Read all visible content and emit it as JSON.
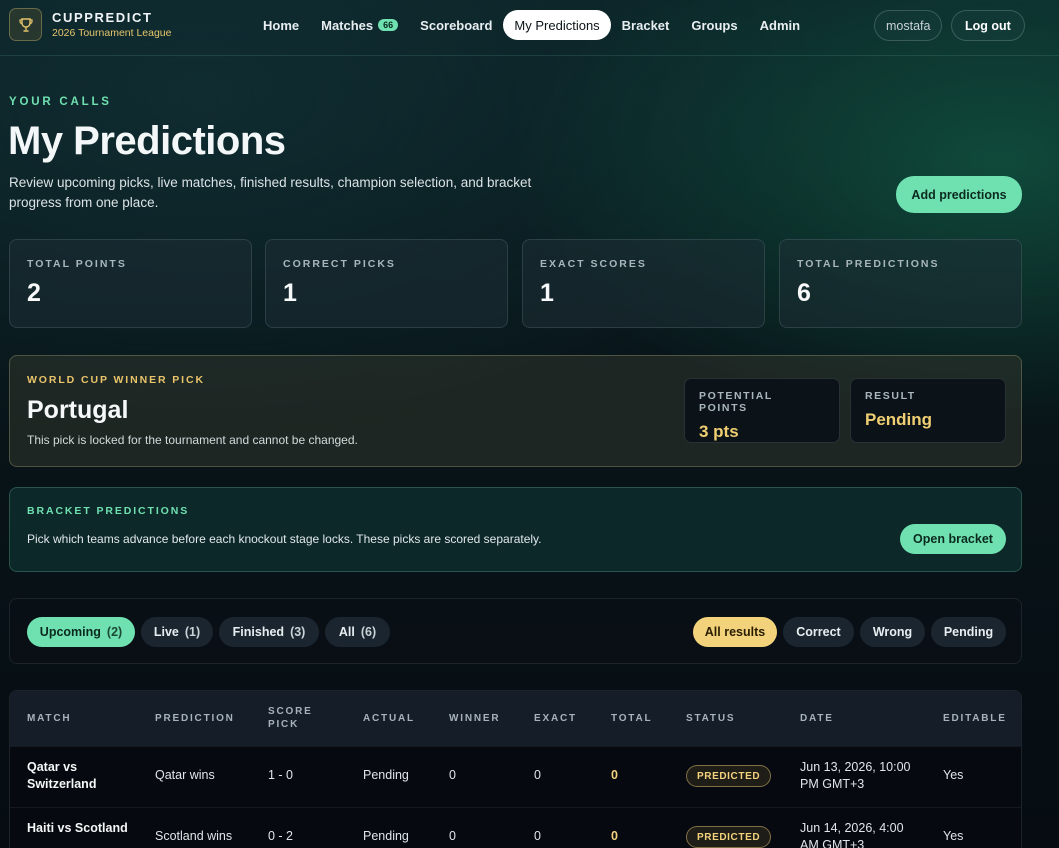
{
  "nav": {
    "brand_name": "CUPPREDICT",
    "brand_sub": "2026 Tournament League",
    "links": [
      {
        "label": "Home"
      },
      {
        "label": "Matches",
        "badge": "66"
      },
      {
        "label": "Scoreboard"
      },
      {
        "label": "My Predictions"
      },
      {
        "label": "Bracket"
      },
      {
        "label": "Groups"
      },
      {
        "label": "Admin"
      }
    ],
    "user": "mostafa",
    "logout": "Log out"
  },
  "header": {
    "eyebrow": "YOUR CALLS",
    "title": "My Predictions",
    "description": "Review upcoming picks, live matches, finished results, champion selection, and bracket progress from one place.",
    "add_button": "Add predictions"
  },
  "stats": [
    {
      "label": "TOTAL POINTS",
      "value": "2"
    },
    {
      "label": "CORRECT PICKS",
      "value": "1"
    },
    {
      "label": "EXACT SCORES",
      "value": "1"
    },
    {
      "label": "TOTAL PREDICTIONS",
      "value": "6"
    }
  ],
  "winner_pick": {
    "label": "WORLD CUP WINNER PICK",
    "team": "Portugal",
    "note": "This pick is locked for the tournament and cannot be changed.",
    "potential_label": "POTENTIAL POINTS",
    "potential_value": "3 pts",
    "result_label": "RESULT",
    "result_value": "Pending"
  },
  "bracket": {
    "label": "BRACKET PREDICTIONS",
    "note": "Pick which teams advance before each knockout stage locks. These picks are scored separately.",
    "button": "Open bracket"
  },
  "filters": {
    "tabs": [
      {
        "label": "Upcoming",
        "count": "(2)"
      },
      {
        "label": "Live",
        "count": "(1)"
      },
      {
        "label": "Finished",
        "count": "(3)"
      },
      {
        "label": "All",
        "count": "(6)"
      }
    ],
    "results": [
      "All results",
      "Correct",
      "Wrong",
      "Pending"
    ]
  },
  "table": {
    "columns": [
      "MATCH",
      "PREDICTION",
      "SCORE PICK",
      "ACTUAL",
      "WINNER",
      "EXACT",
      "TOTAL",
      "STATUS",
      "DATE",
      "EDITABLE"
    ],
    "rows": [
      {
        "match": "Qatar vs Switzerland",
        "prediction": "Qatar wins",
        "score_pick": "1 - 0",
        "actual": "Pending",
        "winner": "0",
        "exact": "0",
        "total": "0",
        "status": "PREDICTED",
        "date": "Jun 13, 2026, 10:00 PM GMT+3",
        "editable": "Yes"
      },
      {
        "match": "Haiti vs Scotland",
        "prediction": "Scotland wins",
        "score_pick": "0 - 2",
        "actual": "Pending",
        "winner": "0",
        "exact": "0",
        "total": "0",
        "status": "PREDICTED",
        "date": "Jun 14, 2026, 4:00 AM GMT+3",
        "editable": "Yes"
      }
    ]
  },
  "colors": {
    "accent_green": "#6fe0b0",
    "accent_gold": "#f3d27c"
  }
}
